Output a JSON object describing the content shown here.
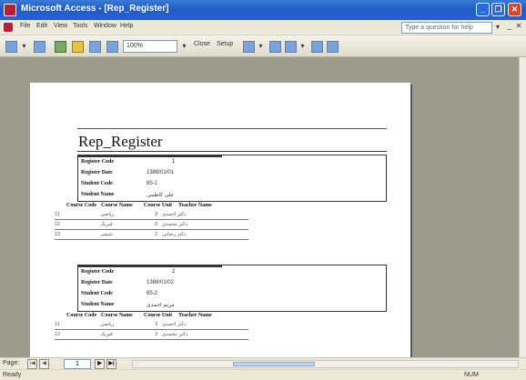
{
  "window": {
    "title": "Microsoft Access - [Rep_Register]",
    "controls": {
      "minimize": "_",
      "restore": "❐",
      "close": "✕"
    }
  },
  "menu": {
    "items": [
      "File",
      "Edit",
      "View",
      "Tools",
      "Window",
      "Help"
    ],
    "help_placeholder": "Type a question for help",
    "help_arrow": "▾",
    "mdi_controls": [
      "_",
      "❐",
      "✕"
    ]
  },
  "toolbar": {
    "zoom_value": "100%",
    "close_label": "Close",
    "setup_label": "Setup",
    "arrows": [
      "▾",
      "▾",
      "▾",
      "▾"
    ]
  },
  "report": {
    "title": "Rep_Register",
    "field_labels": {
      "register_code": "Register Code",
      "register_date": "Register Date",
      "student_code": "Student Code",
      "student_name": "Student Name"
    },
    "detail_headers": [
      "Course Code",
      "Course Name",
      "Course Unit",
      "Teacher Name"
    ],
    "records": [
      {
        "register_code": "1",
        "register_date": "1388/01/01",
        "student_code": "85-1",
        "student_name": "علی کاظمی",
        "details": [
          {
            "course_code": "11",
            "course_name": "ریاضی",
            "course_unit": "3",
            "teacher_name": "دکتر احمدی"
          },
          {
            "course_code": "12",
            "course_name": "فیزیک",
            "course_unit": "3",
            "teacher_name": "دکتر محمدی"
          },
          {
            "course_code": "13",
            "course_name": "شیمی",
            "course_unit": "2",
            "teacher_name": "دکتر رضایی"
          }
        ]
      },
      {
        "register_code": "2",
        "register_date": "1388/01/02",
        "student_code": "85-2",
        "student_name": "مریم احمدی",
        "details": [
          {
            "course_code": "11",
            "course_name": "ریاضی",
            "course_unit": "3",
            "teacher_name": "دکتر احمدی"
          },
          {
            "course_code": "12",
            "course_name": "فیزیک",
            "course_unit": "3",
            "teacher_name": "دکتر محمدی"
          }
        ]
      }
    ]
  },
  "navigation": {
    "page_label": "Page:",
    "page_number": "1",
    "first": "|◀",
    "prev": "◀",
    "next": "▶",
    "last": "▶|"
  },
  "status": {
    "text": "Ready",
    "num": "NUM"
  }
}
